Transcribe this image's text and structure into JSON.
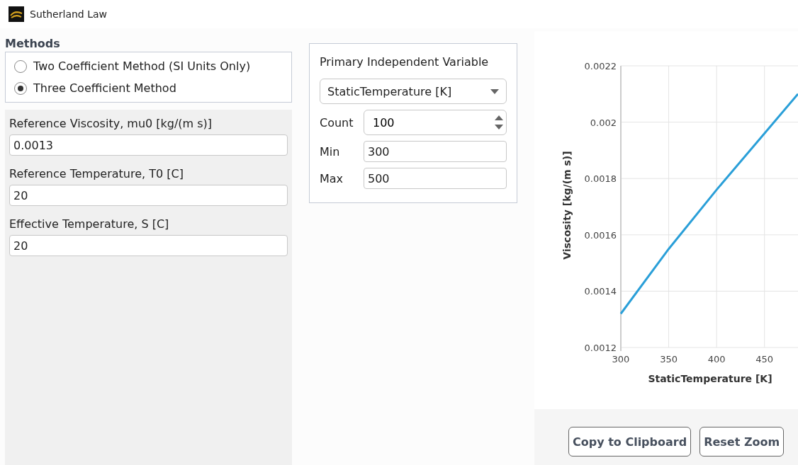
{
  "window": {
    "title": "Sutherland Law"
  },
  "methods": {
    "title": "Methods",
    "options": [
      {
        "label": "Two Coefficient Method (SI Units Only)",
        "selected": false
      },
      {
        "label": "Three Coefficient Method",
        "selected": true
      }
    ]
  },
  "coefficients": [
    {
      "label": "Reference Viscosity, mu0 [kg/(m s)]",
      "value": "0.0013"
    },
    {
      "label": "Reference Temperature, T0 [C]",
      "value": "20"
    },
    {
      "label": "Effective Temperature, S [C]",
      "value": "20"
    }
  ],
  "independent_variable": {
    "title": "Primary Independent Variable",
    "selection": "StaticTemperature [K]",
    "count": {
      "label": "Count",
      "value": "100"
    },
    "min": {
      "label": "Min",
      "value": "300"
    },
    "max": {
      "label": "Max",
      "value": "500"
    }
  },
  "plot": {
    "chart_data": {
      "type": "line",
      "xlabel": "StaticTemperature [K]",
      "ylabel": "Viscosity [kg/(m s)]",
      "x": [
        300,
        350,
        400,
        450,
        485
      ],
      "grid": true,
      "series": [
        {
          "color": "#2a9fd8",
          "values": [
            0.00132,
            0.00155,
            0.00176,
            0.00196,
            0.0021
          ]
        }
      ],
      "xlim": [
        300,
        485
      ],
      "ylim": [
        0.0012,
        0.0022
      ],
      "xticks": [
        300,
        350,
        400,
        450
      ],
      "yticks": [
        {
          "value": 0.0012,
          "label": "0.0012"
        },
        {
          "value": 0.0014,
          "label": "0.0014"
        },
        {
          "value": 0.0016,
          "label": "0.0016"
        },
        {
          "value": 0.0018,
          "label": "0.0018"
        },
        {
          "value": 0.002,
          "label": "0.002"
        },
        {
          "value": 0.0022,
          "label": "0.0022"
        }
      ]
    },
    "buttons": [
      "Copy to Clipboard",
      "Reset Zoom"
    ]
  }
}
